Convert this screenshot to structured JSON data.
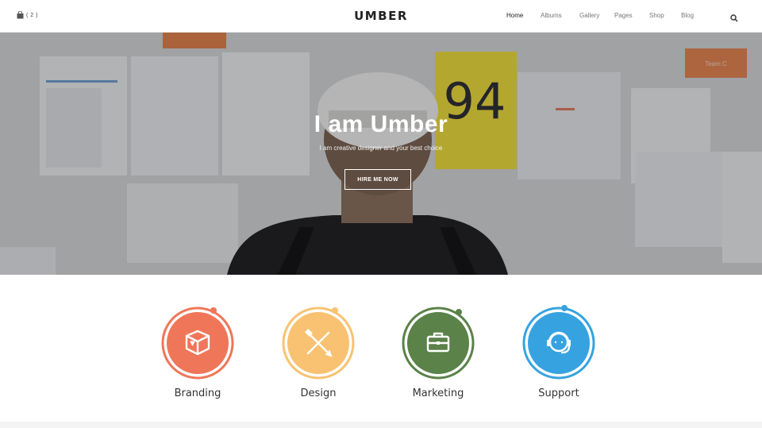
{
  "header": {
    "cart_count": "( 2 )",
    "logo": "UMBER",
    "nav": [
      {
        "label": "Home",
        "active": true
      },
      {
        "label": "Albums",
        "active": false
      },
      {
        "label": "Gallery",
        "active": false
      },
      {
        "label": "Pages",
        "active": false
      },
      {
        "label": "Shop",
        "active": false
      },
      {
        "label": "Blog",
        "active": false
      }
    ]
  },
  "hero": {
    "title": "I am Umber",
    "subtitle": "I am creative designer and your best choice",
    "button_label": "HIRE ME NOW",
    "wall_note_yellow": "94",
    "wall_note_orange": "Team C"
  },
  "services": [
    {
      "label": "Branding",
      "color": "#ef7658",
      "icon": "box-icon"
    },
    {
      "label": "Design",
      "color": "#f8c272",
      "icon": "pencil-ruler-icon"
    },
    {
      "label": "Marketing",
      "color": "#5a8249",
      "icon": "briefcase-icon"
    },
    {
      "label": "Support",
      "color": "#36a3e0",
      "icon": "headset-icon"
    }
  ]
}
